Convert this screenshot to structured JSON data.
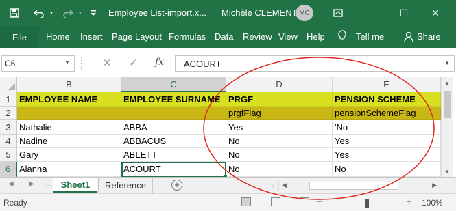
{
  "titlebar": {
    "save_icon": "save-icon",
    "undo_icon": "undo-icon",
    "redo_icon": "redo-icon",
    "customize_icon": "customize-qat-icon",
    "title": "Employee List-import.x...",
    "user_name": "Michèle CLEMENT",
    "avatar_initials": "MC",
    "ribbon_display_icon": "ribbon-display-options-icon",
    "minimize": "—",
    "maximize": "☐",
    "close": "✕"
  },
  "ribbon": {
    "tabs": [
      {
        "label": "File"
      },
      {
        "label": "Home"
      },
      {
        "label": "Insert"
      },
      {
        "label": "Page Layout"
      },
      {
        "label": "Formulas"
      },
      {
        "label": "Data"
      },
      {
        "label": "Review"
      },
      {
        "label": "View"
      },
      {
        "label": "Help"
      },
      {
        "label": "Tell me"
      },
      {
        "label": "Share"
      }
    ],
    "tell_me_icon": "lightbulb-icon",
    "share_icon": "person-icon"
  },
  "formula_bar": {
    "name_box": "C6",
    "cancel_glyph": "✕",
    "enter_glyph": "✓",
    "fx": "fx",
    "value": "ACOURT"
  },
  "grid": {
    "columns": [
      {
        "letter": "B"
      },
      {
        "letter": "C"
      },
      {
        "letter": "D"
      },
      {
        "letter": "E"
      }
    ],
    "rows": [
      {
        "num": "1",
        "cells": [
          "EMPLOYEE NAME",
          "EMPLOYEE SURNAME",
          "PRGF",
          "PENSION SCHEME"
        ]
      },
      {
        "num": "2",
        "cells": [
          "",
          "",
          "prgfFlag",
          "pensionSchemeFlag"
        ]
      },
      {
        "num": "3",
        "cells": [
          "Nathalie",
          "ABBA",
          "Yes",
          "'No"
        ]
      },
      {
        "num": "4",
        "cells": [
          "Nadine",
          "ABBACUS",
          "No",
          "Yes"
        ]
      },
      {
        "num": "5",
        "cells": [
          "Gary",
          "ABLETT",
          "No",
          "Yes"
        ]
      },
      {
        "num": "6",
        "cells": [
          "Alanna",
          "ACOURT",
          "No",
          "No"
        ]
      }
    ],
    "selected_cell": "C6",
    "header_colors": {
      "row1": "#d9e021",
      "row2": "#c9b716"
    },
    "annotation_color": "#e0231c"
  },
  "sheets": {
    "tabs": [
      {
        "label": "Sheet1",
        "active": true
      },
      {
        "label": "Reference",
        "active": false
      }
    ],
    "add_glyph": "+"
  },
  "status": {
    "text": "Ready",
    "zoom_minus": "−",
    "zoom_plus": "+",
    "zoom": "100%"
  },
  "colors": {
    "excel_green": "#217346"
  }
}
